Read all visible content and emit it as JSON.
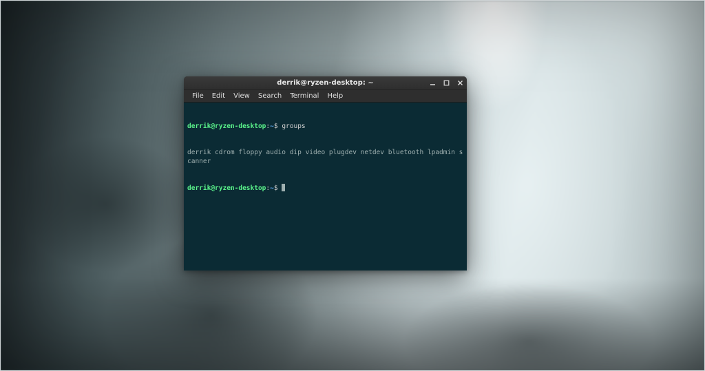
{
  "window": {
    "title": "derrik@ryzen-desktop: ~"
  },
  "menubar": {
    "items": [
      {
        "label": "File"
      },
      {
        "label": "Edit"
      },
      {
        "label": "View"
      },
      {
        "label": "Search"
      },
      {
        "label": "Terminal"
      },
      {
        "label": "Help"
      }
    ]
  },
  "icons": {
    "minimize": "minimize-icon",
    "maximize": "maximize-icon",
    "close": "close-icon"
  },
  "terminal": {
    "prompt_user_host": "derrik@ryzen-desktop",
    "prompt_separator": ":",
    "prompt_path": "~",
    "prompt_symbol": "$",
    "lines": [
      {
        "command": "groups"
      },
      {
        "output": "derrik cdrom floppy audio dip video plugdev netdev bluetooth lpadmin scanner"
      },
      {
        "command": ""
      }
    ]
  },
  "colors": {
    "terminal_bg": "#0b2b34",
    "prompt_user": "#5af28a",
    "prompt_path": "#5a9fe0",
    "text": "#9fb0b0"
  }
}
